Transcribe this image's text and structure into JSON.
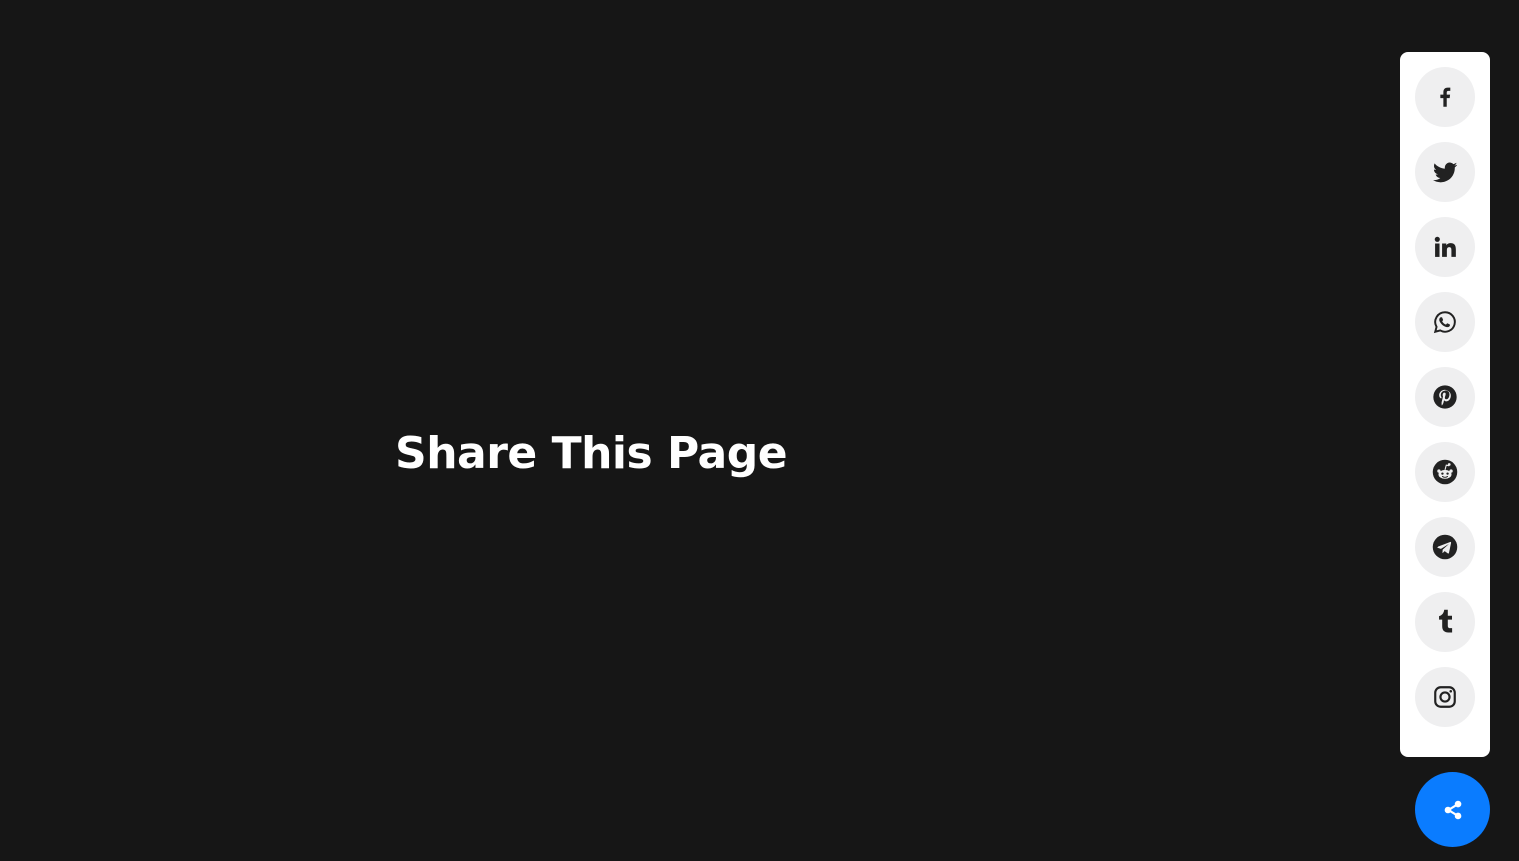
{
  "page": {
    "title": "Share This Page",
    "background_color": "#161616"
  },
  "share_menu": {
    "icon_color": "#222222",
    "button_background": "#efeff0",
    "items": [
      {
        "network": "facebook",
        "icon": "facebook-icon"
      },
      {
        "network": "twitter",
        "icon": "twitter-icon"
      },
      {
        "network": "linkedin",
        "icon": "linkedin-icon"
      },
      {
        "network": "whatsapp",
        "icon": "whatsapp-icon"
      },
      {
        "network": "pinterest",
        "icon": "pinterest-icon"
      },
      {
        "network": "reddit",
        "icon": "reddit-icon"
      },
      {
        "network": "telegram",
        "icon": "telegram-icon"
      },
      {
        "network": "tumblr",
        "icon": "tumblr-icon"
      },
      {
        "network": "instagram",
        "icon": "instagram-icon"
      }
    ]
  },
  "share_toggle": {
    "icon": "share-icon",
    "color": "#0a7cff"
  }
}
